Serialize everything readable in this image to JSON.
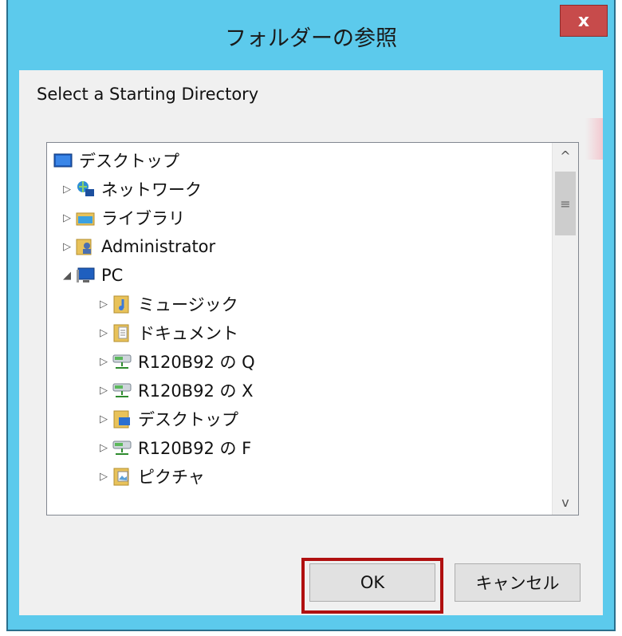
{
  "window": {
    "title": "フォルダーの参照",
    "close_label": "x"
  },
  "instruction": "Select a Starting Directory",
  "tree": {
    "items": [
      {
        "label": "デスクトップ",
        "icon": "desktop-icon",
        "arrow": ""
      },
      {
        "label": "ネットワーク",
        "icon": "network-icon",
        "arrow": "▷"
      },
      {
        "label": "ライブラリ",
        "icon": "library-icon",
        "arrow": "▷"
      },
      {
        "label": "Administrator",
        "icon": "user-folder-icon",
        "arrow": "▷"
      },
      {
        "label": "PC",
        "icon": "pc-icon",
        "arrow": "◢"
      },
      {
        "label": "ミュージック",
        "icon": "music-folder-icon",
        "arrow": "▷"
      },
      {
        "label": "ドキュメント",
        "icon": "documents-folder-icon",
        "arrow": "▷"
      },
      {
        "label": "R120B92 の Q",
        "icon": "network-drive-icon",
        "arrow": "▷"
      },
      {
        "label": "R120B92 の X",
        "icon": "network-drive-icon",
        "arrow": "▷"
      },
      {
        "label": "デスクトップ",
        "icon": "desktop-folder-icon",
        "arrow": "▷"
      },
      {
        "label": "R120B92 の F",
        "icon": "network-drive-icon",
        "arrow": "▷"
      },
      {
        "label": "ピクチャ",
        "icon": "pictures-folder-icon",
        "arrow": "▷"
      }
    ]
  },
  "scrollbar": {
    "up": "^",
    "grip": "≡",
    "down": "v"
  },
  "buttons": {
    "ok": "OK",
    "cancel": "キャンセル"
  },
  "colors": {
    "titlebar": "#5ccaec",
    "close": "#c74b4b",
    "highlight": "#b01010"
  }
}
